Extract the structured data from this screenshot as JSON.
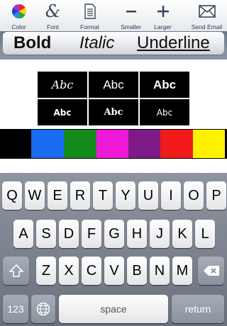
{
  "toolbar": {
    "items": [
      {
        "label": "Color",
        "icon": "color-wheel-icon"
      },
      {
        "label": "Font",
        "icon": "ampersand-icon"
      },
      {
        "label": "Format",
        "icon": "document-icon"
      },
      {
        "label": "Smaller",
        "icon": "minus-icon"
      },
      {
        "label": "Larger",
        "icon": "plus-icon"
      },
      {
        "label": "Send Email",
        "icon": "envelope-icon"
      }
    ]
  },
  "styles": {
    "bold": "Bold",
    "italic": "Italic",
    "underline": "Underline"
  },
  "fonts": [
    "Abc",
    "Abc",
    "Abc",
    "Abc",
    "Abc",
    "Abc"
  ],
  "colors": [
    "#000000",
    "#1a6cf0",
    "#138a1a",
    "#ee19d8",
    "#7d1a88",
    "#f11a1a",
    "#fff200"
  ],
  "keyboard": {
    "row1": [
      "Q",
      "W",
      "E",
      "R",
      "T",
      "Y",
      "U",
      "I",
      "O",
      "P"
    ],
    "row2": [
      "A",
      "S",
      "D",
      "F",
      "G",
      "H",
      "J",
      "K",
      "L"
    ],
    "row3": [
      "Z",
      "X",
      "C",
      "V",
      "B",
      "N",
      "M"
    ],
    "numbers_label": "123",
    "space_label": "space",
    "return_label": "return"
  }
}
